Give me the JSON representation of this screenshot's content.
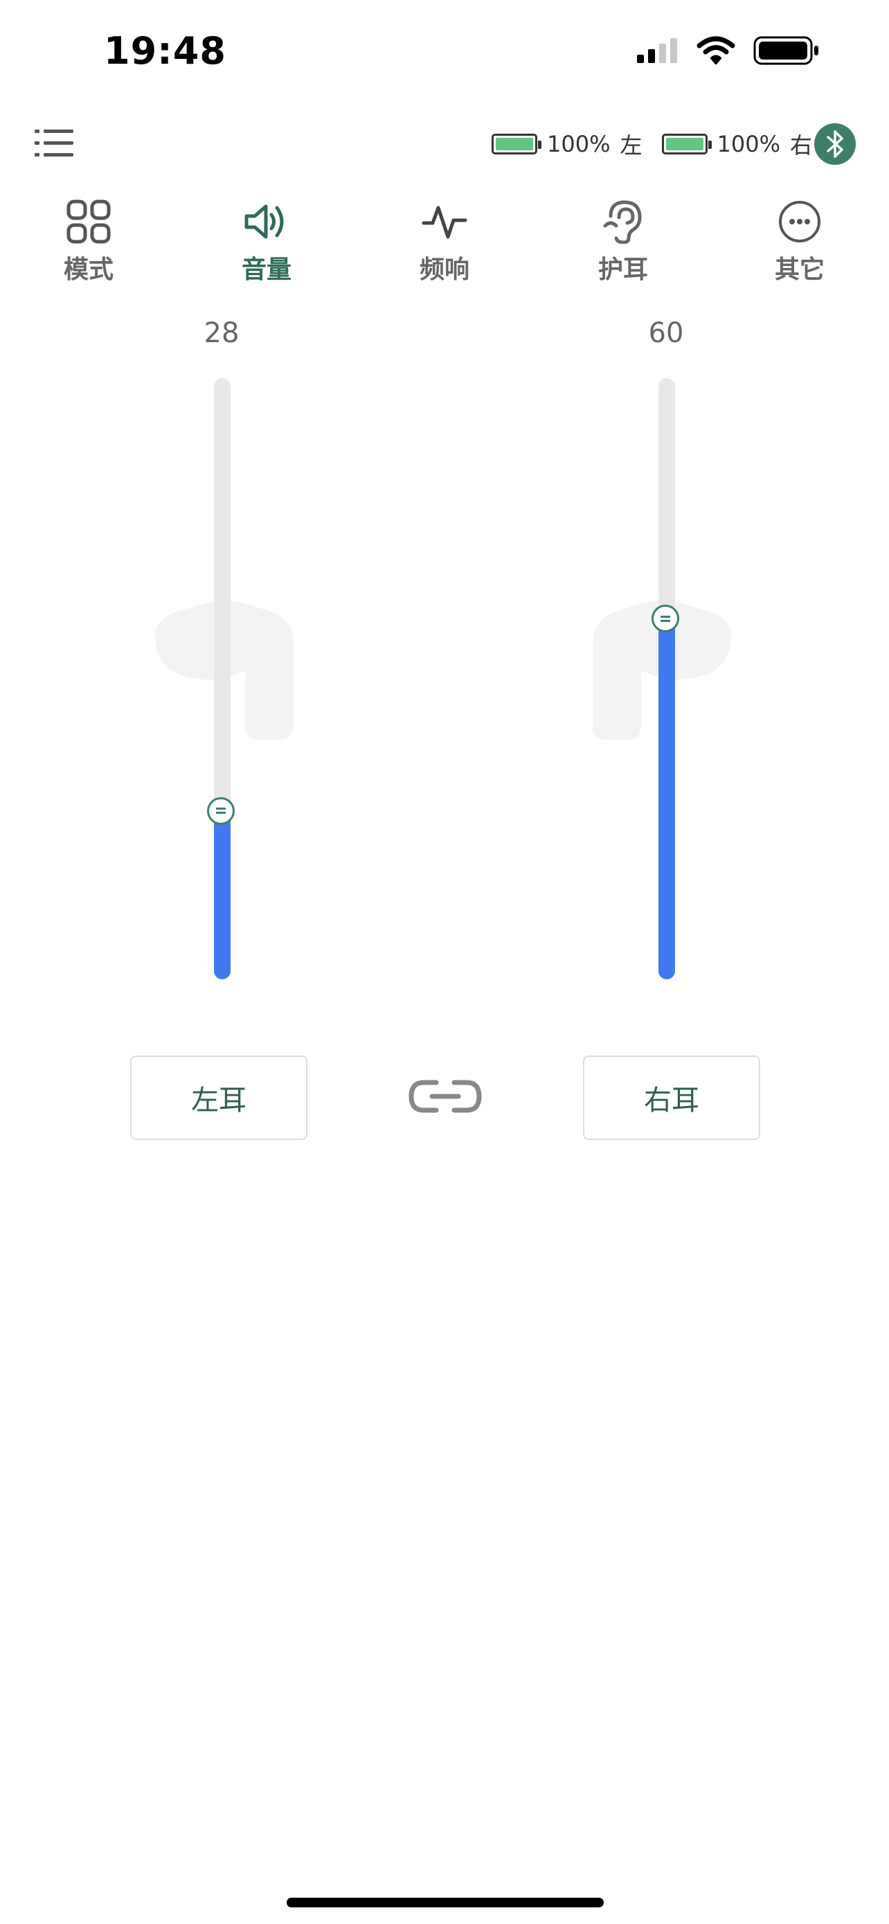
{
  "status_bar": {
    "time": "19:48"
  },
  "header": {
    "left_battery": {
      "level_percent": 100,
      "text": "100%",
      "side": "左"
    },
    "right_battery": {
      "level_percent": 100,
      "text": "100%",
      "side": "右"
    },
    "battery_color": "#63c584",
    "bluetooth_color": "#3e7f68"
  },
  "tabs": [
    {
      "label": "模式",
      "icon": "grid-icon"
    },
    {
      "label": "音量",
      "icon": "speaker-icon",
      "active": true
    },
    {
      "label": "频响",
      "icon": "waveform-icon"
    },
    {
      "label": "护耳",
      "icon": "ear-icon"
    },
    {
      "label": "其它",
      "icon": "more-icon"
    }
  ],
  "volume": {
    "left": {
      "value": "28",
      "level": 0.28,
      "ear_label": "左耳"
    },
    "right": {
      "value": "60",
      "level": 0.6,
      "ear_label": "右耳"
    },
    "fill_color": "#4279f0",
    "linked": true
  }
}
